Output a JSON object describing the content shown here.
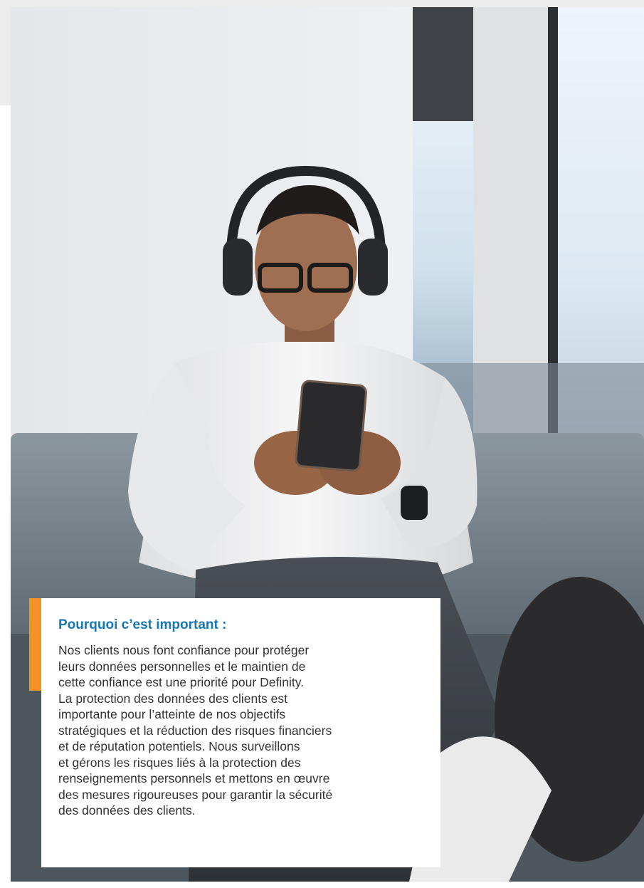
{
  "colors": {
    "accent": "#f39325",
    "heading": "#1676b6"
  },
  "callout": {
    "heading": "Pourquoi c’est important :",
    "lines": [
      "Nos clients nous font confiance pour protéger",
      "leurs données personnelles et le maintien de",
      "cette confiance est une priorité pour Definity.",
      "La protection des données des clients est",
      "importante pour l’atteinte de nos objectifs",
      "stratégiques et la réduction des risques financiers",
      "et de réputation potentiels. Nous surveillons",
      "et gérons les risques liés à la protection des",
      "renseignements personnels et mettons en œuvre",
      "des mesures rigoureuses pour garantir la sécurité",
      "des données des clients."
    ]
  }
}
